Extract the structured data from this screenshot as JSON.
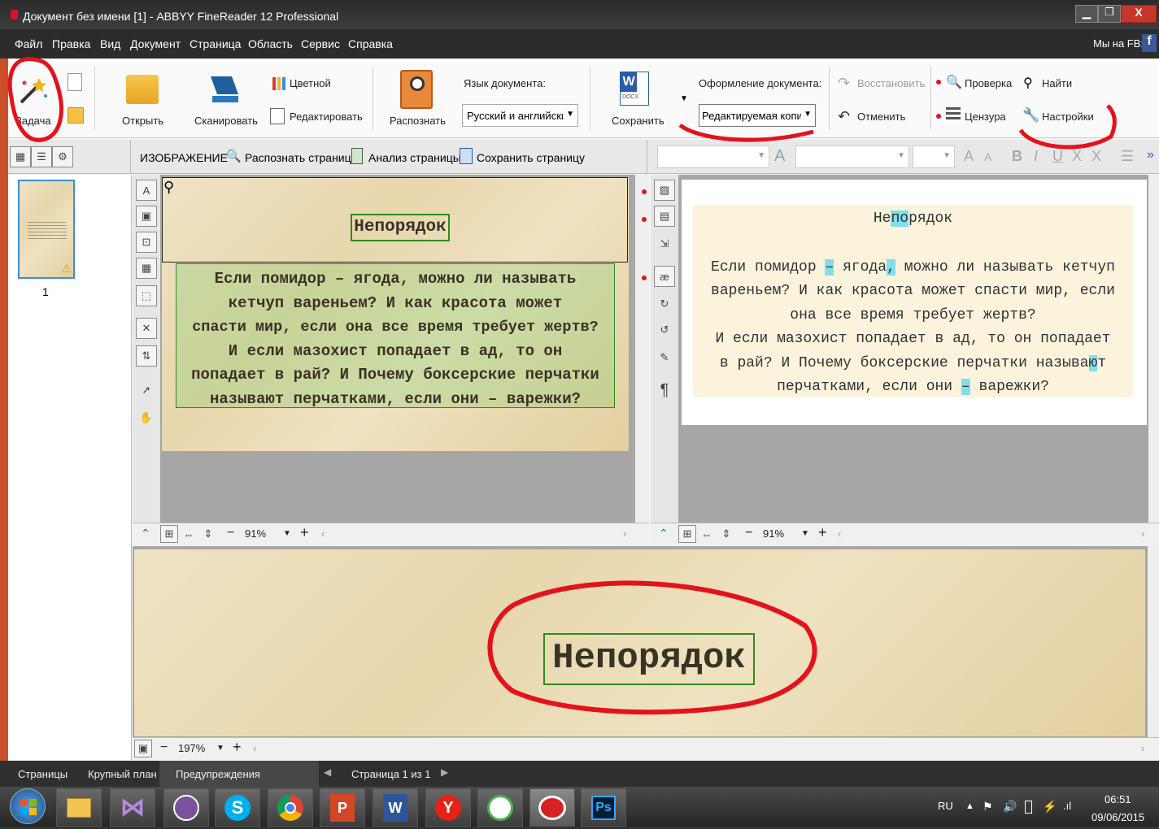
{
  "window": {
    "title": "Документ без имени [1] - ABBYY FineReader 12 Professional",
    "fb_label": "Мы на FB:"
  },
  "menu": [
    "Файл",
    "Правка",
    "Вид",
    "Документ",
    "Страница",
    "Область",
    "Сервис",
    "Справка"
  ],
  "ribbon": {
    "task": "Задача",
    "open": "Открыть",
    "scan": "Сканировать",
    "color": "Цветной",
    "edit": "Редактировать",
    "recognize": "Распознать",
    "lang_label": "Язык документа:",
    "lang_value": "Русский и английски",
    "save": "Сохранить",
    "format_label": "Оформление документа:",
    "format_value": "Редактируемая копия",
    "restore": "Восстановить",
    "undo": "Отменить",
    "verify": "Проверка",
    "censor": "Цензура",
    "find": "Найти",
    "settings": "Настройки",
    "word_icon_small": "DOCX"
  },
  "image_bar": {
    "title": "ИЗОБРАЖЕНИЕ",
    "recognize_page": "Распознать страницу",
    "analyze_page": "Анализ страницы",
    "save_page": "Сохранить страницу"
  },
  "pages_panel": {
    "page_number": "1"
  },
  "image": {
    "heading": "Непорядок",
    "lines": [
      "Если помидор – ягода, можно ли называть",
      "кетчуп вареньем? И как красота может",
      "спасти мир, если она все время требует жертв?",
      "И если мазохист попадает в ад, то он",
      "попадает в рай? И Почему боксерские перчатки",
      "называют перчатками, если они – варежки?"
    ]
  },
  "text_panel": {
    "heading_a": "Не",
    "heading_b": "по",
    "heading_c": "рядок",
    "lines": [
      {
        "a": "Если помидор ",
        "h": "–",
        "b": " ягода",
        "h2": ",",
        "c": " можно ли называть кетчуп"
      },
      {
        "a": "вареньем? И как красота может спасти мир, если",
        "h": "",
        "b": "",
        "h2": "",
        "c": ""
      },
      {
        "a": "она все время требует жертв?",
        "h": "",
        "b": "",
        "h2": "",
        "c": ""
      },
      {
        "a": "И если мазохист попадает в ад, то он попадает",
        "h": "",
        "b": "",
        "h2": "",
        "c": ""
      },
      {
        "a": "в рай? И Почему боксерские перчатки называ",
        "h": "ю",
        "b": "т",
        "h2": "",
        "c": ""
      },
      {
        "a": "перчатками, если они ",
        "h": "–",
        "b": " варежки?",
        "h2": "",
        "c": ""
      }
    ]
  },
  "zoom": {
    "image": "91%",
    "text": "91%",
    "closeup": "197%"
  },
  "closeup": {
    "heading": "Непорядок"
  },
  "status_tabs": {
    "pages": "Страницы",
    "closeup": "Крупный план",
    "warnings": "Предупреждения",
    "page_of": "Страница 1 из 1"
  },
  "taskbar": {
    "lang": "RU",
    "time": "06:51",
    "date": "09/06/2015"
  },
  "colors": {
    "accent_red": "#e4121c",
    "highlight": "#7fe0ea",
    "green_frame": "#2e8b20"
  }
}
